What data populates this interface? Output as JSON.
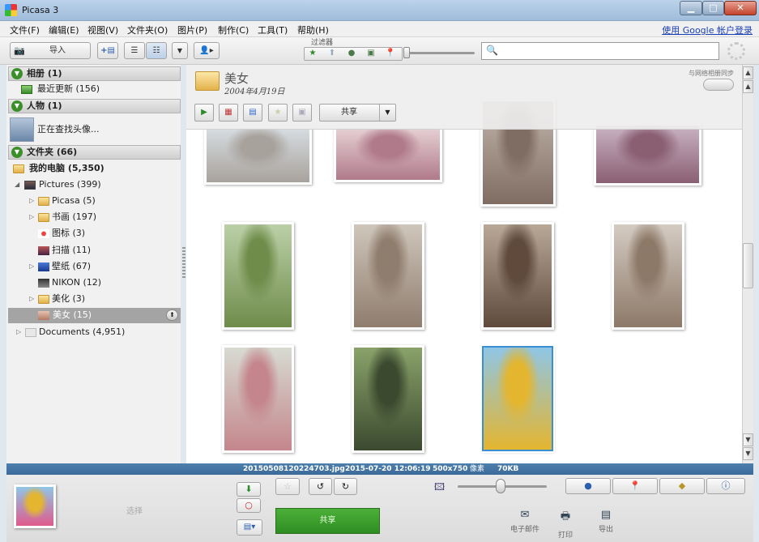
{
  "window": {
    "title": "Picasa 3",
    "minimize": "▁",
    "maximize": "□",
    "close": "✕"
  },
  "menu": {
    "items": [
      "文件(F)",
      "编辑(E)",
      "视图(V)",
      "文件夹(O)",
      "图片(P)",
      "制作(C)",
      "工具(T)",
      "帮助(H)"
    ],
    "login": "使用 Google 帐户登录"
  },
  "toolbar": {
    "import_label": "导入",
    "filter_label": "过滤器",
    "search_placeholder": ""
  },
  "sidebar": {
    "albums": {
      "label": "相册 (1)",
      "recent": "最近更新 (156)"
    },
    "people": {
      "label": "人物 (1)",
      "finding": "正在查找头像..."
    },
    "folders": {
      "label": "文件夹 (66)"
    },
    "my_computer": "我的电脑 (5,350)",
    "pictures": "Pictures (399)",
    "items": [
      "Picasa (5)",
      "书画 (197)",
      "图标 (3)",
      "扫描 (11)",
      "壁纸 (67)",
      "NIKON (12)",
      "美化 (3)",
      "美女 (15)"
    ],
    "documents": "Documents (4,951)"
  },
  "album": {
    "title": "美女",
    "date": "2004年4月19日",
    "share_label": "共享",
    "web_sync_label": "与网络相册同步"
  },
  "photo_colors": [
    [
      "#d7dde2",
      "#a8a29c"
    ],
    [
      "#e6d1d5",
      "#b07a8a"
    ],
    [
      "#c3b7ad",
      "#7f6c62"
    ],
    [
      "#c9b3c4",
      "#8a5f72"
    ],
    [
      "#bcd0a8",
      "#6f8c4a"
    ],
    [
      "#cfc6bb",
      "#8f7d6e"
    ],
    [
      "#b9a898",
      "#5f4a3c"
    ],
    [
      "#d4cbc2",
      "#8d7968"
    ],
    [
      "#d7dbd2",
      "#c4868c"
    ],
    [
      "#8aa26a",
      "#3b4a2f"
    ],
    [
      "#8fc6e6",
      "#e4b52f"
    ]
  ],
  "infobar": {
    "filename": "20150508120224703.jpg",
    "datetime": "2015-07-20 12:06:19",
    "dimensions": "500x750",
    "pixel_unit": "像素",
    "filesize": "70KB"
  },
  "bottom": {
    "selected_label": "选择",
    "share_label": "共享",
    "email_label": "电子邮件",
    "print_label": "打印",
    "export_label": "导出"
  },
  "colors": {
    "infobar": "#3f6e9c",
    "share_button": "#3a9a2c",
    "selection": "#3d8fd4"
  }
}
